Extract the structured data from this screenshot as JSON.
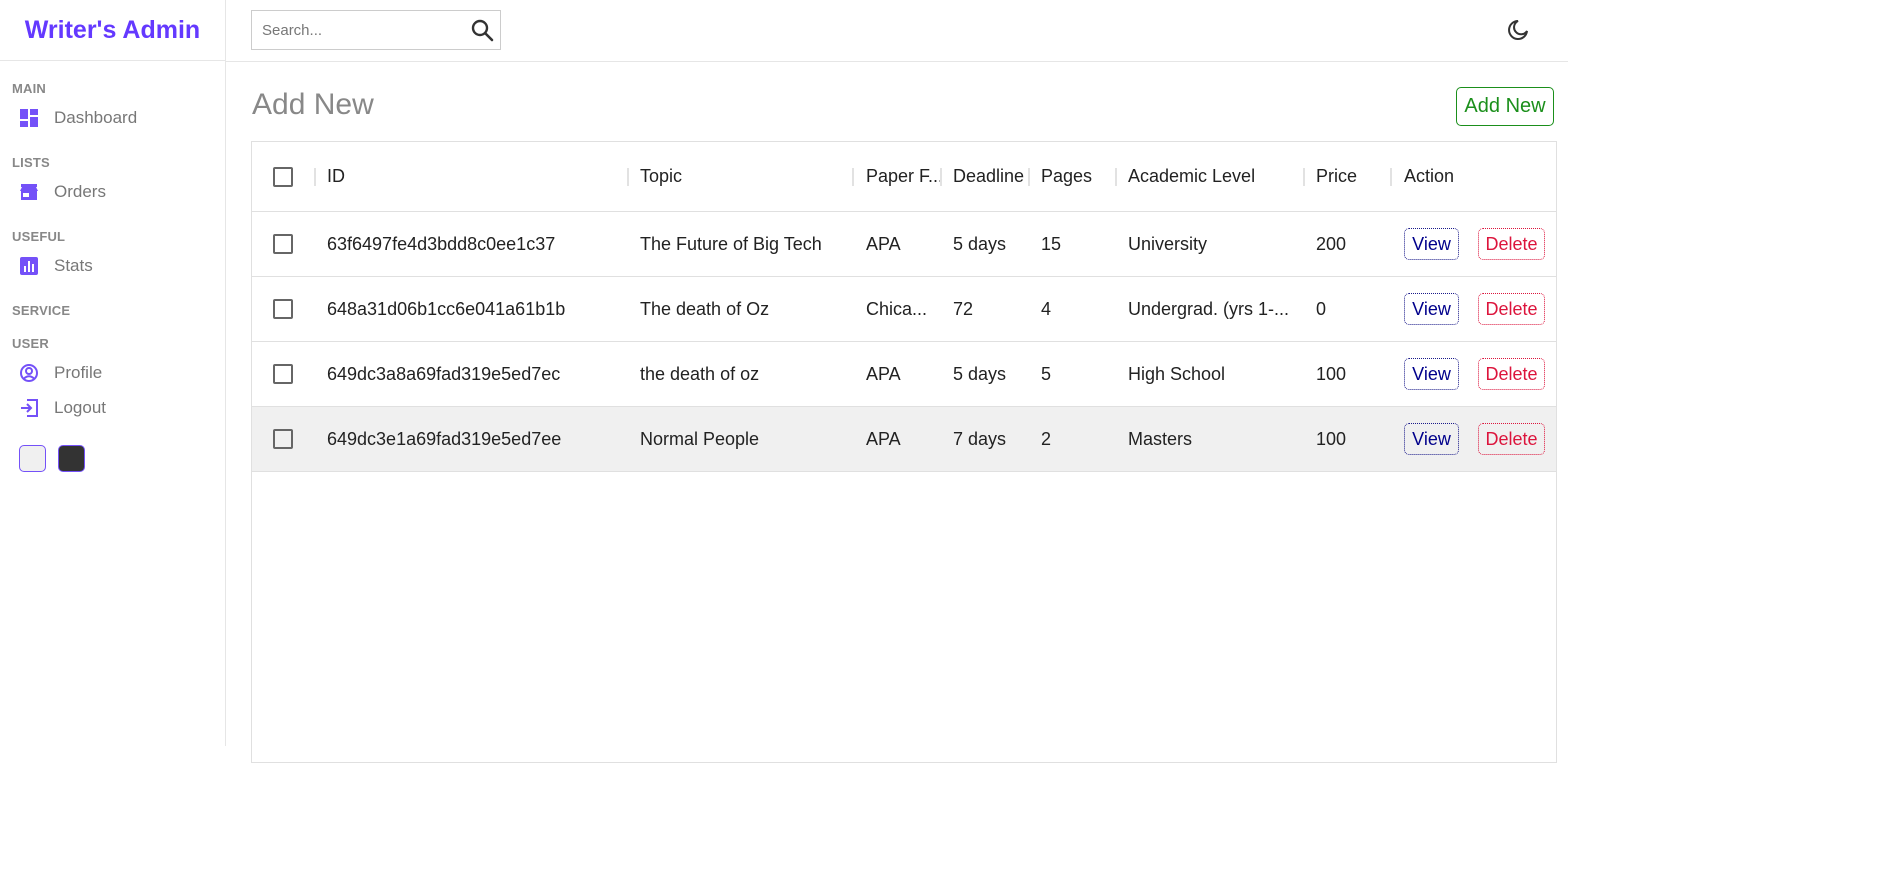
{
  "app": {
    "title": "Writer's Admin"
  },
  "search": {
    "placeholder": "Search..."
  },
  "sidebar": {
    "sections": [
      {
        "title": "MAIN",
        "items": [
          {
            "label": "Dashboard",
            "icon": "dashboard-icon"
          }
        ]
      },
      {
        "title": "LISTS",
        "items": [
          {
            "label": "Orders",
            "icon": "store-icon"
          }
        ]
      },
      {
        "title": "USEFUL",
        "items": [
          {
            "label": "Stats",
            "icon": "stats-icon"
          }
        ]
      },
      {
        "title": "SERVICE",
        "items": []
      },
      {
        "title": "USER",
        "items": [
          {
            "label": "Profile",
            "icon": "profile-icon"
          },
          {
            "label": "Logout",
            "icon": "logout-icon"
          }
        ]
      }
    ],
    "swatches": [
      {
        "name": "light",
        "color": "#f0f0f0"
      },
      {
        "name": "dark",
        "color": "#333333"
      }
    ]
  },
  "page": {
    "title": "Add New",
    "add_button": "Add New"
  },
  "colors": {
    "accent": "#6439ff",
    "add_green": "#1b8f1b",
    "view_blue": "#00008b",
    "delete_red": "#dc143c"
  },
  "table": {
    "columns": [
      "ID",
      "Topic",
      "Paper F...",
      "Deadline",
      "Pages",
      "Academic Level",
      "Price",
      "Action"
    ],
    "view_label": "View",
    "delete_label": "Delete",
    "rows": [
      {
        "id": "63f6497fe4d3bdd8c0ee1c37",
        "topic": "The Future of Big Tech",
        "paper_format": "APA",
        "deadline": "5 days",
        "pages": "15",
        "academic_level": "University",
        "price": "200"
      },
      {
        "id": "648a31d06b1cc6e041a61b1b",
        "topic": "The death of Oz",
        "paper_format": "Chica...",
        "deadline": "72",
        "pages": "4",
        "academic_level": "Undergrad. (yrs 1-...",
        "price": "0"
      },
      {
        "id": "649dc3a8a69fad319e5ed7ec",
        "topic": "the death of oz",
        "paper_format": "APA",
        "deadline": "5 days",
        "pages": "5",
        "academic_level": "High School",
        "price": "100"
      },
      {
        "id": "649dc3e1a69fad319e5ed7ee",
        "topic": "Normal People",
        "paper_format": "APA",
        "deadline": "7 days",
        "pages": "2",
        "academic_level": "Masters",
        "price": "100"
      }
    ]
  }
}
